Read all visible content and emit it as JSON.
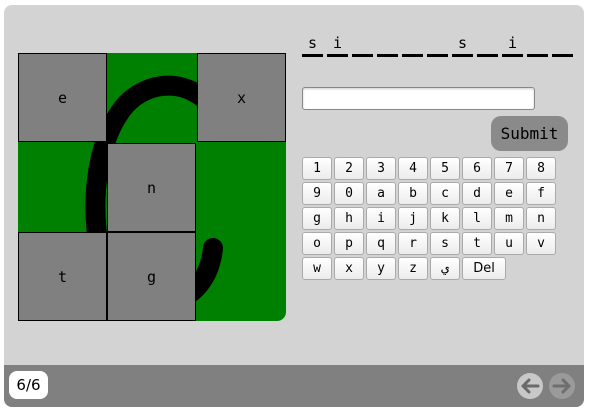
{
  "puzzle": {
    "tiles": [
      "e",
      "x",
      "n",
      "t",
      "g"
    ],
    "background_color": "#008000"
  },
  "word": {
    "slots": [
      "s",
      "i",
      "",
      "",
      "",
      "",
      "s",
      "",
      "i",
      "",
      ""
    ]
  },
  "answer": {
    "value": "",
    "placeholder": ""
  },
  "submit_label": "Submit",
  "keyboard": {
    "row1": [
      "1",
      "2",
      "3",
      "4",
      "5",
      "6",
      "7",
      "8"
    ],
    "row2": [
      "9",
      "0",
      "a",
      "b",
      "c",
      "d",
      "e",
      "f"
    ],
    "row3": [
      "g",
      "h",
      "i",
      "j",
      "k",
      "l",
      "m",
      "n"
    ],
    "row4": [
      "o",
      "p",
      "q",
      "r",
      "s",
      "t",
      "u",
      "v"
    ],
    "row5": [
      "w",
      "x",
      "y",
      "z",
      "ي",
      "Del"
    ]
  },
  "footer": {
    "counter": "6/6",
    "prev_icon": "arrow-left-icon",
    "next_icon": "arrow-right-icon"
  }
}
